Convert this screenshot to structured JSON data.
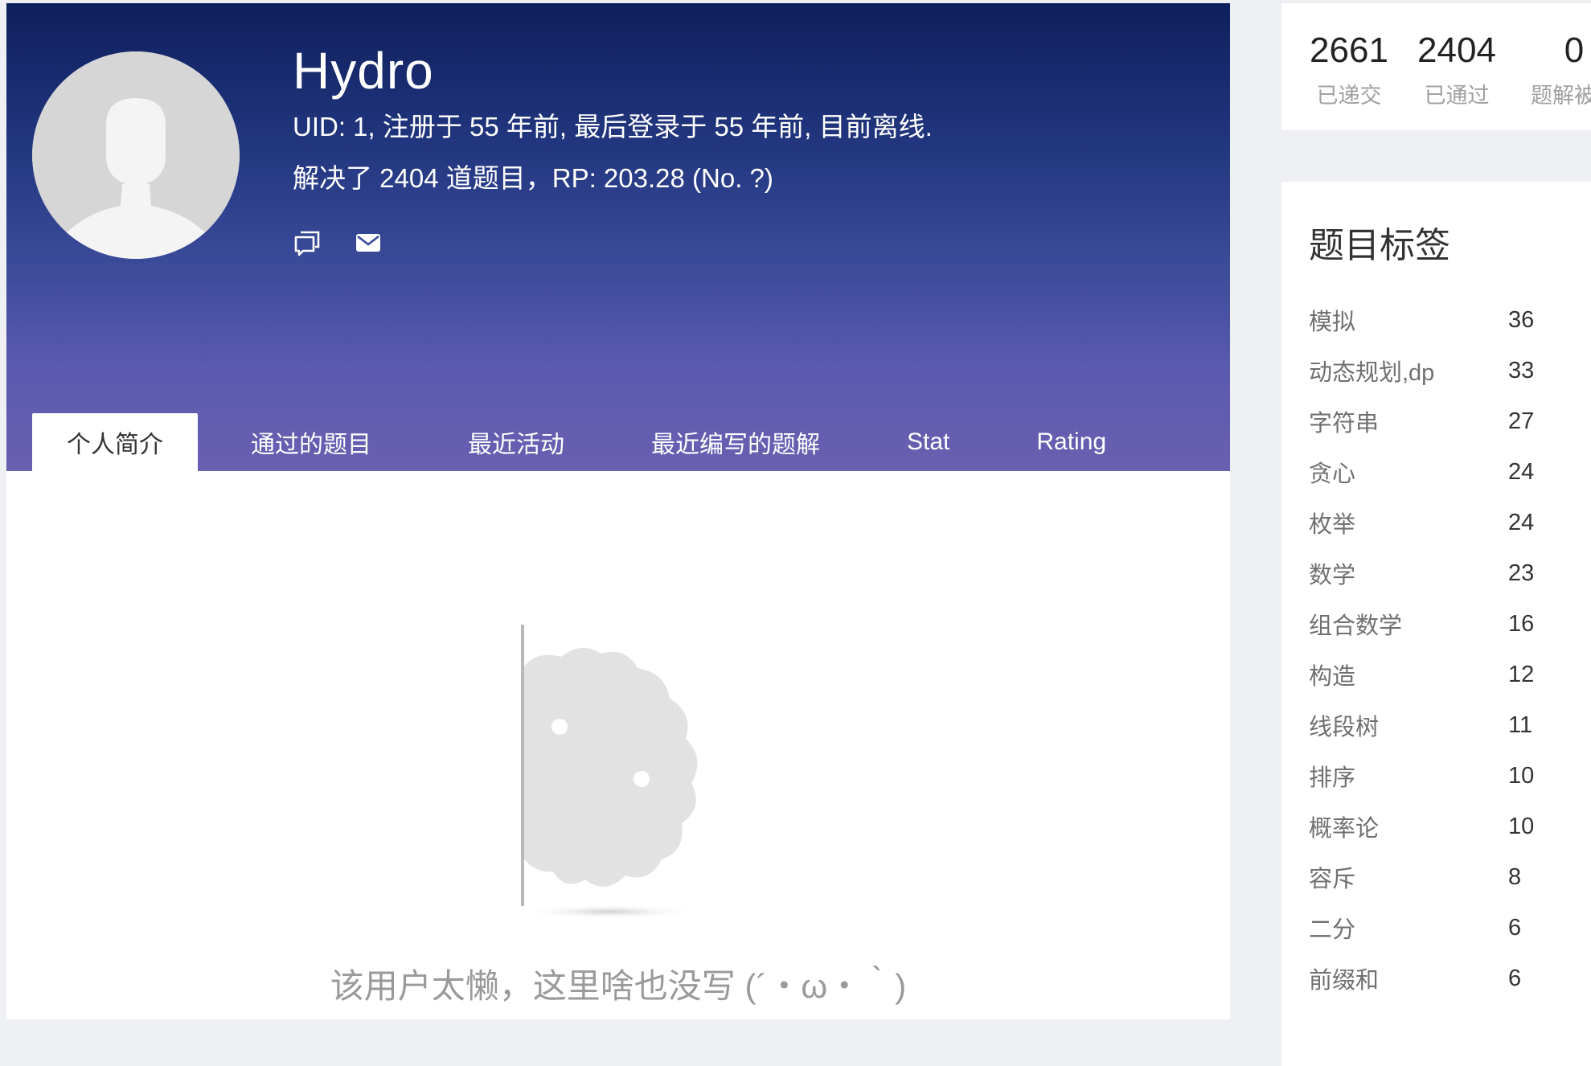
{
  "profile": {
    "username": "Hydro",
    "info_line_1": "UID: 1, 注册于 55 年前, 最后登录于 55 年前, 目前离线.",
    "info_line_2": "解决了 2404 道题目，RP: 203.28 (No. ?)",
    "actions": [
      {
        "icon": "message-icon"
      },
      {
        "icon": "mail-icon"
      }
    ]
  },
  "tabs": [
    {
      "label": "个人简介",
      "active": true
    },
    {
      "label": "通过的题目",
      "active": false
    },
    {
      "label": "最近活动",
      "active": false
    },
    {
      "label": "最近编写的题解",
      "active": false
    },
    {
      "label": "Stat",
      "active": false
    },
    {
      "label": "Rating",
      "active": false
    }
  ],
  "empty_state": {
    "text": "该用户太懒，这里啥也没写 (´・ω・｀)"
  },
  "stats": [
    {
      "value": "2661",
      "label": "已递交"
    },
    {
      "value": "2404",
      "label": "已通过"
    },
    {
      "value": "0",
      "label": "题解被赞"
    }
  ],
  "tags_card": {
    "title": "题目标签",
    "tags": [
      {
        "name": "模拟",
        "count": "36"
      },
      {
        "name": "动态规划,dp",
        "count": "33"
      },
      {
        "name": "字符串",
        "count": "27"
      },
      {
        "name": "贪心",
        "count": "24"
      },
      {
        "name": "枚举",
        "count": "24"
      },
      {
        "name": "数学",
        "count": "23"
      },
      {
        "name": "组合数学",
        "count": "16"
      },
      {
        "name": "构造",
        "count": "12"
      },
      {
        "name": "线段树",
        "count": "11"
      },
      {
        "name": "排序",
        "count": "10"
      },
      {
        "name": "概率论",
        "count": "10"
      },
      {
        "name": "容斥",
        "count": "8"
      },
      {
        "name": "二分",
        "count": "6"
      },
      {
        "name": "前缀和",
        "count": "6"
      }
    ]
  }
}
